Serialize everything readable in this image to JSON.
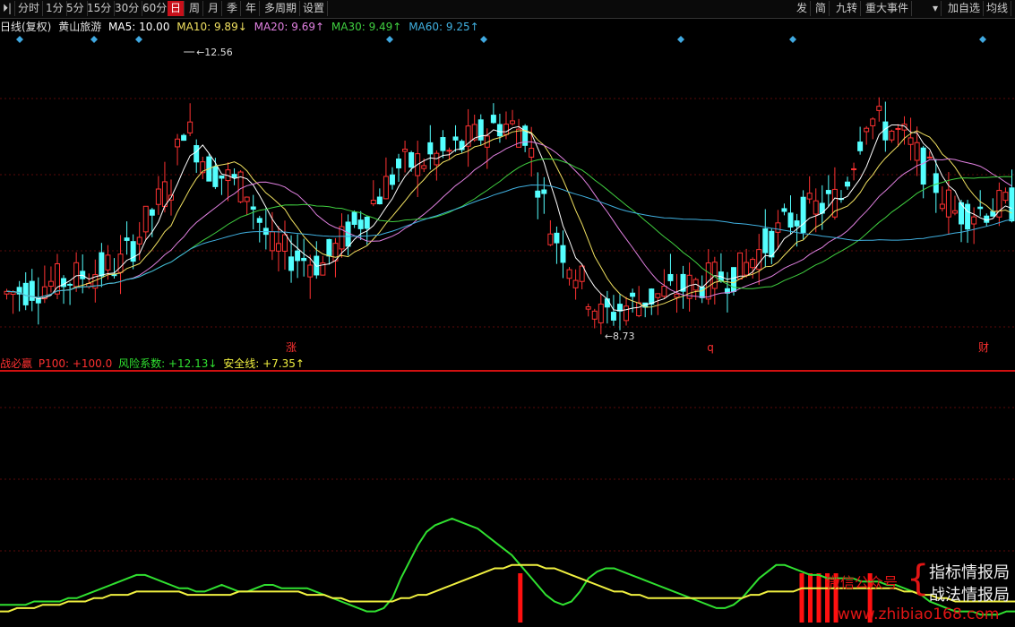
{
  "toolbar": {
    "left": [
      "⏵|",
      "分时",
      "1分",
      "5分",
      "15分",
      "30分",
      "60分",
      "日",
      "周",
      "月",
      "季",
      "年",
      "多周期",
      "设置"
    ],
    "active_index": 7,
    "right": [
      "发",
      "简",
      "九转",
      "重大事件",
      "▾",
      "加自选",
      "均线"
    ]
  },
  "main_info": {
    "label": "日线(复权)",
    "stock": "黄山旅游",
    "ma5": "MA5: 10.00",
    "ma10": "MA10: 9.89↓",
    "ma20": "MA20: 9.69↑",
    "ma30": "MA30: 9.49↑",
    "ma60": "MA60: 9.25↑"
  },
  "indicator_info": {
    "name": "战必赢",
    "p100": "P100: +100.0",
    "risk": "风险系数: +12.13↓",
    "safe": "安全线: +7.35↑"
  },
  "price_labels": {
    "high": "12.56",
    "low": "8.73"
  },
  "event_markers": [
    "涨",
    "q",
    "财"
  ],
  "watermark": {
    "left": "微信公众号",
    "line1": "指标情报局",
    "line2": "战法情报局",
    "url": "www.zhibiao168.com"
  },
  "colors": {
    "up": "#ff3232",
    "down": "#54ffff",
    "ma5": "#ffffff",
    "ma10": "#f0e060",
    "ma20": "#e080e0",
    "ma30": "#40d040",
    "ma60": "#40b0e0",
    "risk": "#30e030",
    "safe": "#f0f040",
    "bar": "#ff1010"
  },
  "chart_data": {
    "type": "candlestick",
    "series_count": 160,
    "high": 12.56,
    "low": 8.73,
    "indicator": {
      "risk_series": [
        4,
        4,
        4,
        4,
        5,
        5,
        5,
        5,
        6,
        6,
        7,
        8,
        9,
        10,
        11,
        12,
        13,
        13,
        12,
        11,
        10,
        9,
        9,
        8,
        8,
        9,
        10,
        9,
        8,
        8,
        9,
        10,
        10,
        9,
        9,
        9,
        9,
        8,
        7,
        6,
        5,
        4,
        3,
        2,
        2,
        3,
        6,
        12,
        17,
        22,
        26,
        28,
        29,
        30,
        29,
        28,
        27,
        25,
        23,
        21,
        19,
        16,
        13,
        10,
        7,
        5,
        4,
        5,
        8,
        12,
        14,
        15,
        15,
        14,
        13,
        12,
        11,
        10,
        9,
        8,
        7,
        6,
        5,
        4,
        3,
        3,
        4,
        6,
        9,
        12,
        14,
        16,
        16,
        15,
        14,
        13,
        13,
        12,
        12,
        12,
        12,
        11,
        11,
        11,
        10,
        10,
        9,
        8,
        7,
        5,
        4,
        3,
        2,
        2,
        2,
        1,
        1,
        1,
        2,
        2
      ],
      "safe_series": [
        2,
        2,
        3,
        3,
        3,
        4,
        4,
        4,
        5,
        5,
        5,
        6,
        6,
        7,
        7,
        7,
        8,
        8,
        8,
        8,
        8,
        8,
        7,
        7,
        7,
        7,
        7,
        7,
        8,
        8,
        8,
        8,
        8,
        8,
        8,
        8,
        7,
        7,
        7,
        6,
        6,
        5,
        5,
        5,
        5,
        5,
        5,
        6,
        6,
        7,
        7,
        8,
        9,
        10,
        11,
        12,
        13,
        14,
        15,
        15,
        16,
        16,
        16,
        16,
        15,
        15,
        14,
        13,
        12,
        11,
        10,
        9,
        8,
        8,
        7,
        7,
        6,
        6,
        6,
        6,
        6,
        6,
        6,
        6,
        6,
        6,
        6,
        6,
        7,
        7,
        8,
        8,
        8,
        8,
        9,
        9,
        9,
        9,
        9,
        9,
        9,
        9,
        9,
        9,
        9,
        9,
        8,
        8,
        7,
        7,
        6,
        6,
        5,
        5,
        5,
        5,
        5,
        5,
        5,
        5
      ],
      "red_bars": [
        61,
        94,
        95,
        96,
        97,
        98,
        102,
        126,
        144,
        145
      ]
    }
  }
}
